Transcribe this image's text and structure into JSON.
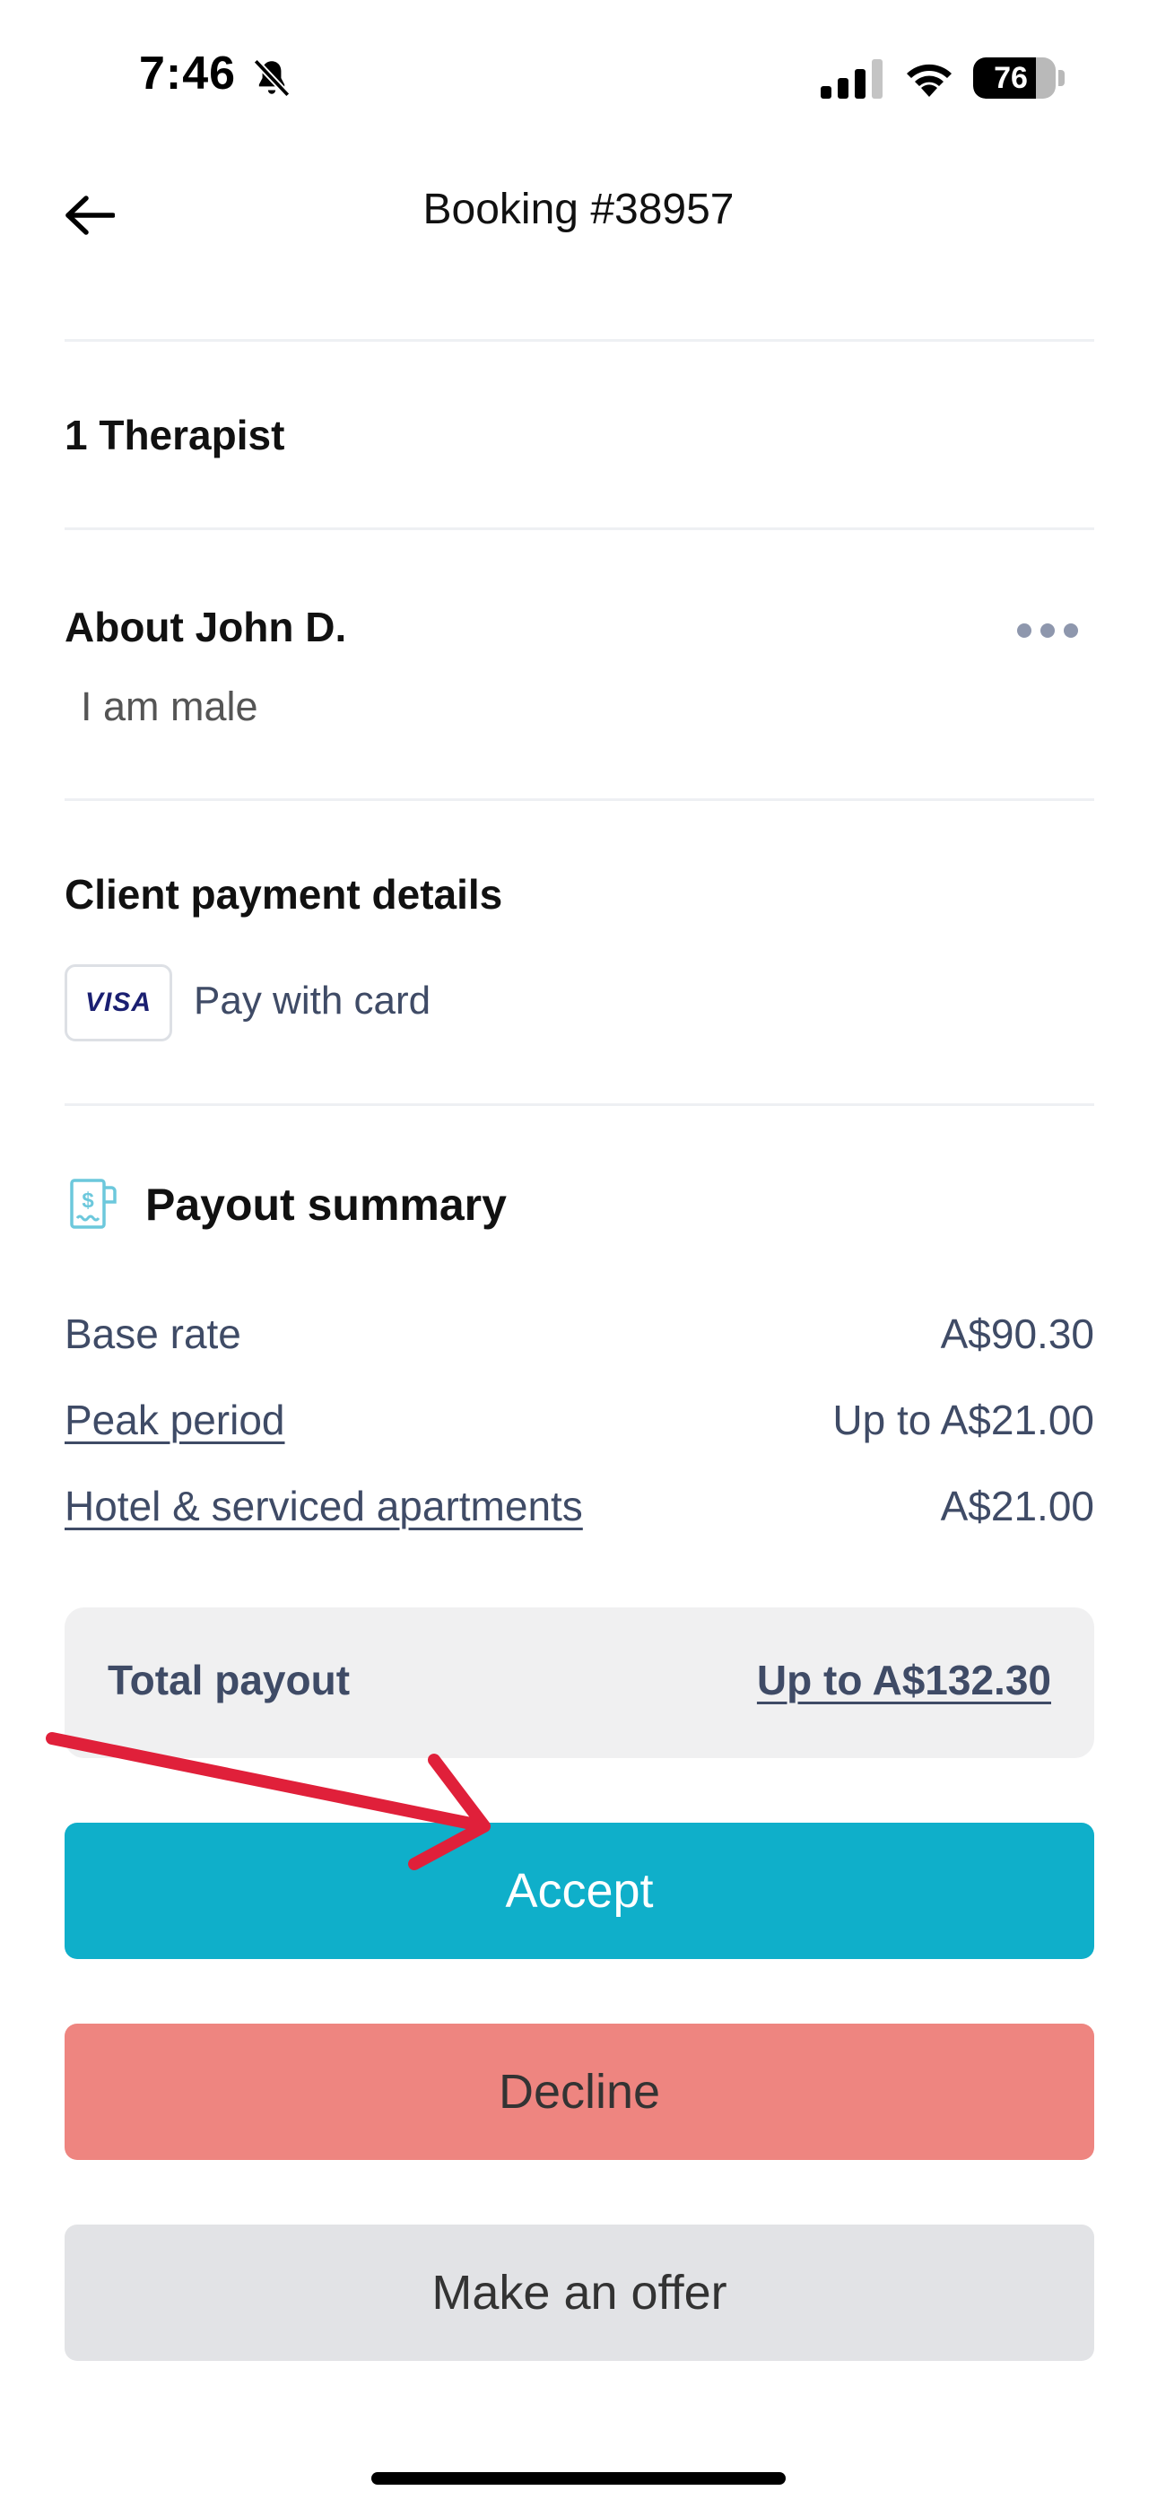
{
  "status_bar": {
    "time": "7:46",
    "battery_level": "76",
    "battery_fraction": 0.76,
    "icons": [
      "bell-slash-icon",
      "cellular-signal-icon",
      "wifi-icon",
      "battery-icon"
    ]
  },
  "header": {
    "title": "Booking #38957",
    "back_icon": "arrow-left-icon"
  },
  "therapist": {
    "count_label": "1 Therapist"
  },
  "about": {
    "title": "About John D.",
    "text": "I am male",
    "more_icon": "more-horizontal-icon"
  },
  "payment": {
    "title": "Client payment details",
    "card_brand": "VISA",
    "method": "Pay with card"
  },
  "payout": {
    "title": "Payout summary",
    "icon": "receipt-dollar-icon",
    "items": [
      {
        "label": "Base rate",
        "value": "A$90.30",
        "is_link": false
      },
      {
        "label": "Peak period",
        "value": "Up to A$21.00",
        "is_link": true
      },
      {
        "label": "Hotel & serviced apartments",
        "value": "A$21.00",
        "is_link": true
      }
    ],
    "total_label": "Total payout",
    "total_value": "Up to A$132.30"
  },
  "actions": {
    "accept": "Accept",
    "decline": "Decline",
    "offer": "Make an offer"
  },
  "colors": {
    "accept_bg": "#0fafca",
    "decline_bg": "#ee8580",
    "offer_bg": "#e2e3e6",
    "text_muted": "#3f4b66",
    "annotation_arrow": "#e0203a",
    "payout_icon": "#6cc8dc"
  }
}
